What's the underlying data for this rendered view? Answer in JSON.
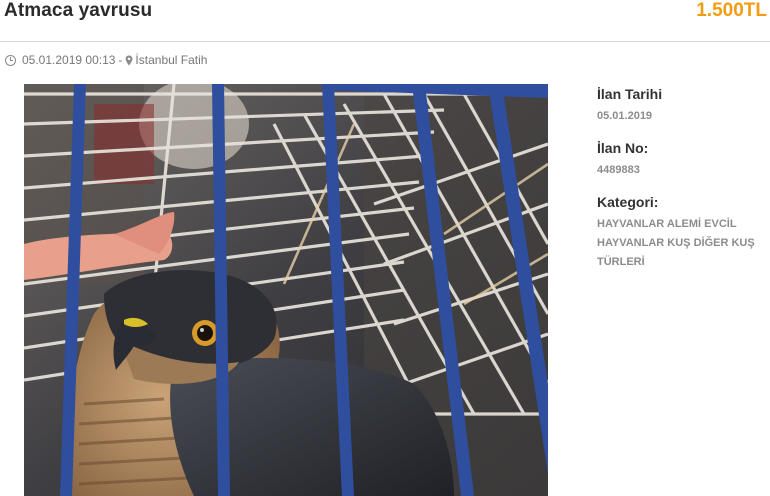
{
  "listing": {
    "title": "Atmaca yavrusu",
    "price": "1.500TL",
    "datetime": "05.01.2019 00:13",
    "separator": "-",
    "location": "İstanbul Fatih"
  },
  "photo": {
    "alt": "Sparrowhawk chick in a blue wire cage"
  },
  "details": {
    "date_label": "İlan Tarihi",
    "date_value": "05.01.2019",
    "number_label": "İlan No:",
    "number_value": "4489883",
    "category_label": "Kategori:",
    "category_lines": [
      "HAYVANLAR ALEMİ EVCİL",
      "HAYVANLAR KUŞ DİĞER KUŞ",
      "TÜRLERİ"
    ]
  },
  "icons": {
    "time": "clock-icon",
    "location": "map-pin-icon"
  },
  "colors": {
    "price": "#f39c12",
    "cage_bar": "#2f4f9e"
  }
}
